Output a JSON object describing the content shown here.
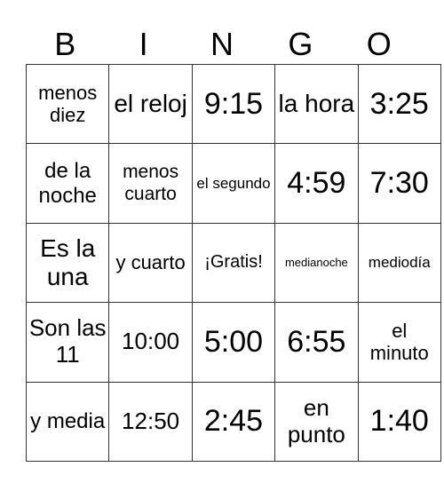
{
  "header": [
    "B",
    "I",
    "N",
    "G",
    "O"
  ],
  "rows": [
    [
      {
        "t": "menos diez",
        "s": 22
      },
      {
        "t": "el reloj",
        "s": 28
      },
      {
        "t": "9:15",
        "s": 34
      },
      {
        "t": "la hora",
        "s": 28
      },
      {
        "t": "3:25",
        "s": 34
      }
    ],
    [
      {
        "t": "de la noche",
        "s": 24
      },
      {
        "t": "menos cuarto",
        "s": 21
      },
      {
        "t": "el segundo",
        "s": 17
      },
      {
        "t": "4:59",
        "s": 34
      },
      {
        "t": "7:30",
        "s": 34
      }
    ],
    [
      {
        "t": "Es la una",
        "s": 28
      },
      {
        "t": "y cuarto",
        "s": 22
      },
      {
        "t": "¡Gratis!",
        "s": 20
      },
      {
        "t": "medianoche",
        "s": 13
      },
      {
        "t": "mediodía",
        "s": 17
      }
    ],
    [
      {
        "t": "Son las 11",
        "s": 26
      },
      {
        "t": "10:00",
        "s": 26
      },
      {
        "t": "5:00",
        "s": 34
      },
      {
        "t": "6:55",
        "s": 34
      },
      {
        "t": "el minuto",
        "s": 22
      }
    ],
    [
      {
        "t": "y media",
        "s": 24
      },
      {
        "t": "12:50",
        "s": 26
      },
      {
        "t": "2:45",
        "s": 34
      },
      {
        "t": "en punto",
        "s": 26
      },
      {
        "t": "1:40",
        "s": 34
      }
    ]
  ]
}
